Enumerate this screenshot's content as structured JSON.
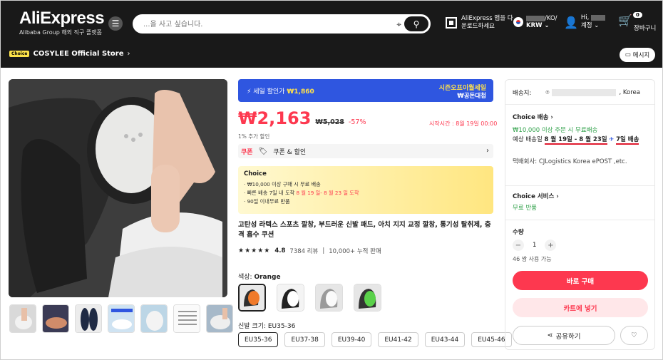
{
  "header": {
    "brand": "AliExpress",
    "brand_sub": "Alibaba Group 해외 직구 플랫폼",
    "search_placeholder": "...을 사고 싶습니다.",
    "app_line1": "AliExpress 앱을 다",
    "app_line2": "운로드하세요",
    "region_line1": "/KO/",
    "region_line2": "KRW",
    "account_line1": "Hi,",
    "account_line2": "계정",
    "cart_count": "0",
    "cart_label": "장바구니",
    "store_badge": "Choice",
    "store_name": "COSYLEE Official Store",
    "message_button": "메시지"
  },
  "product": {
    "sale_banner_left": "세일 할인가",
    "sale_banner_price": "₩1,860",
    "sale_banner_right1": "시즌오프이월세일",
    "sale_banner_right2": "₩공돈대첩",
    "price_now": "₩2,163",
    "price_old": "₩5,028",
    "discount": "-57%",
    "timer": "시작시간 : 8월 19일 00:00",
    "extra_discount": "1% 추가 할인",
    "coupon_badge": "쿠폰",
    "coupon_text": "쿠폰 & 할인",
    "choice_title": "Choice",
    "choice_line1": "· ₩10,000 이상 구매 시 무료 배송",
    "choice_line2_pre": "· 빠른 배송 7일 내 도착 ",
    "choice_line2_red": "8 월 19 일- 8 월 23 일 도착",
    "choice_line3": "· 90일 이내무료 반품",
    "title": "고탄성 라텍스 스포츠 깔창, 부드러운 신발 패드, 아치 지지 교정 깔창, 통기성 탈취제, 충격 흡수 쿠션",
    "stars": "★★★★★",
    "rating": "4.8",
    "reviews": "7384 리뷰",
    "sold": "10,000+ 누적 판매",
    "color_label": "색상: ",
    "color_value": "Orange",
    "size_label": "신발 크기: EU35-36",
    "sizes": [
      "EU35-36",
      "EU37-38",
      "EU39-40",
      "EU41-42",
      "EU43-44",
      "EU45-46"
    ]
  },
  "shipping": {
    "ship_label": "배송지:",
    "ship_country": ", Korea",
    "choice_delivery": "Choice 배송",
    "free_shipping": "₩10,000 이상 주문 시 무료배송",
    "eta_label": "예상 배송일 ",
    "eta_dates": "8 월 19일 - 8 월 23일",
    "eta_days": "7일 배송",
    "carrier": "택배회사: CJLogistics Korea ePOST ,etc.",
    "choice_service": "Choice 서비스",
    "free_return": "무료 반품",
    "qty_label": "수량",
    "qty_value": "1",
    "available": "46 쌍 사용 가능",
    "buy_now": "바로 구매",
    "add_cart": "카트에 넣기",
    "share": "공유하기"
  },
  "colors": {
    "accent": "#fd384f",
    "header_bg": "#191919",
    "banner_blue": "#2f56e0",
    "green": "#30a14a"
  }
}
